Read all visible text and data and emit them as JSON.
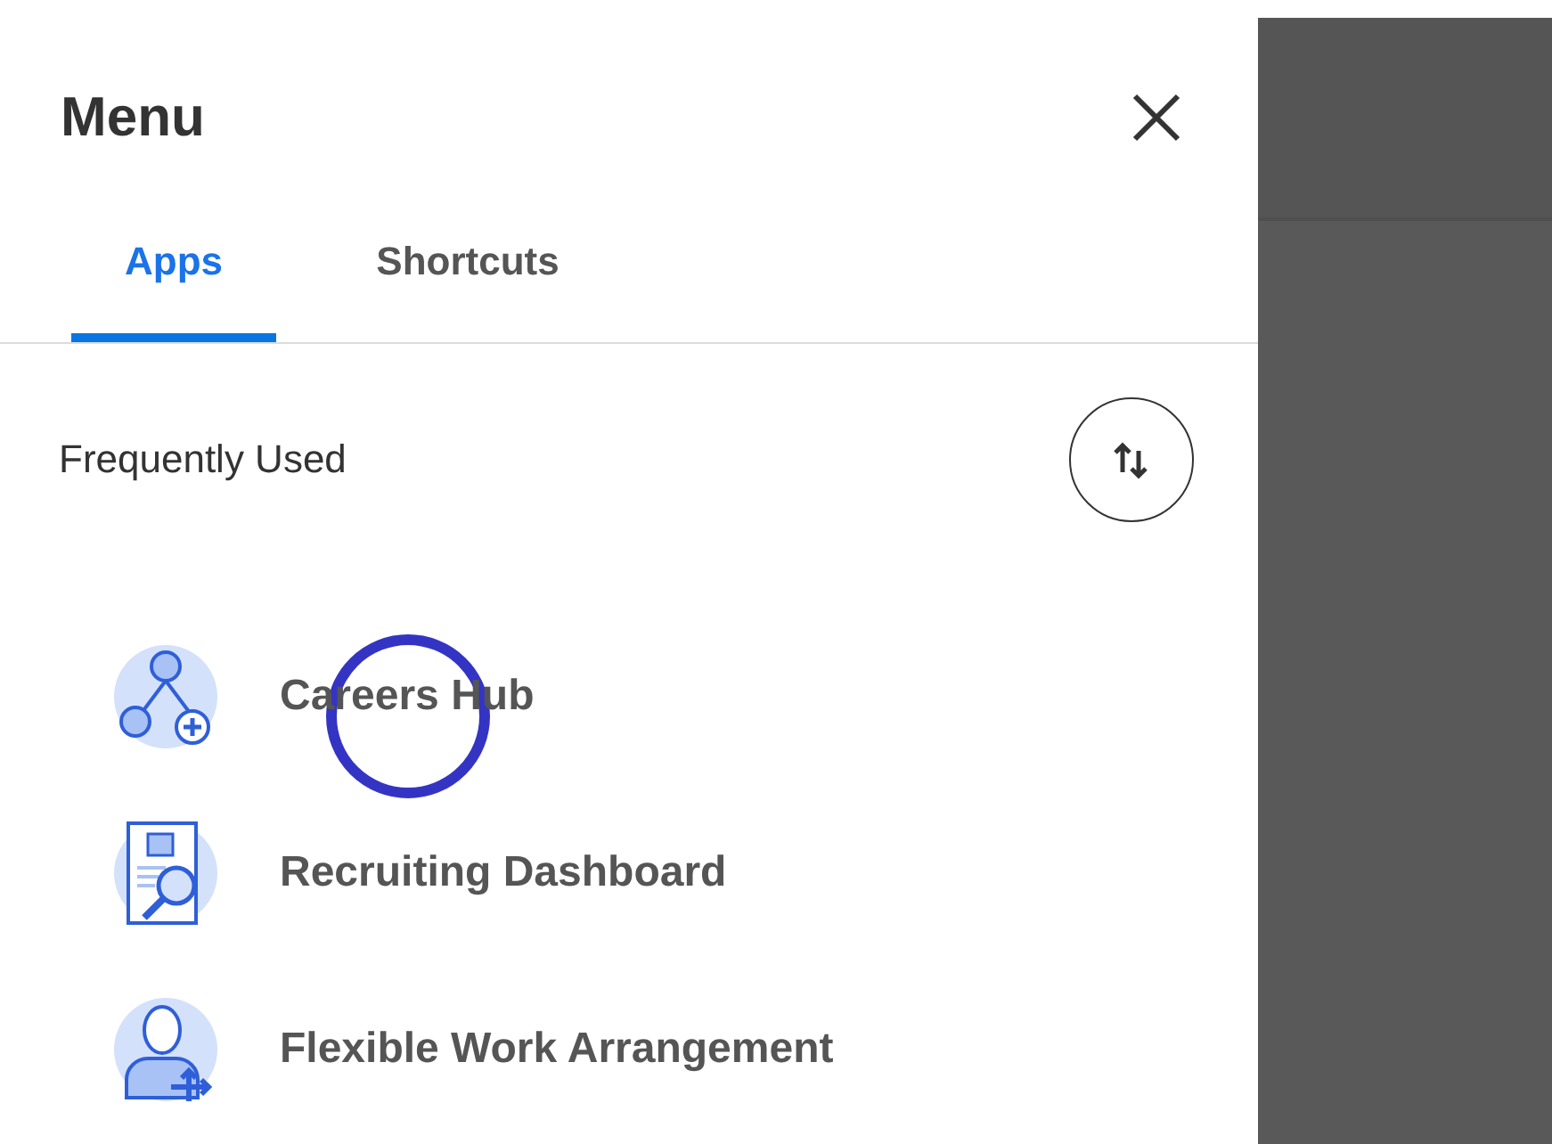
{
  "menu": {
    "title": "Menu"
  },
  "tabs": [
    {
      "label": "Apps",
      "selected": true
    },
    {
      "label": "Shortcuts",
      "selected": false
    }
  ],
  "section": {
    "title": "Frequently Used"
  },
  "apps": [
    {
      "label": "Careers Hub"
    },
    {
      "label": "Recruiting Dashboard"
    },
    {
      "label": "Flexible Work Arrangement"
    }
  ]
}
